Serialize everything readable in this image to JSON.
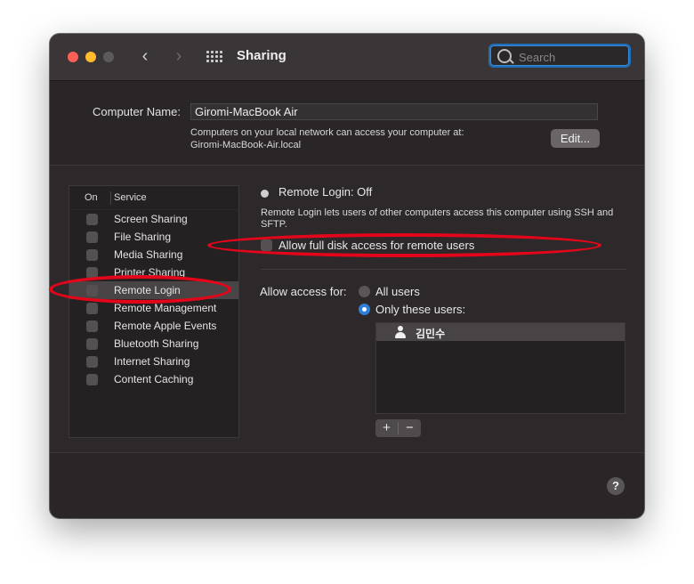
{
  "window": {
    "title": "Sharing",
    "search_placeholder": "Search",
    "nav_back": "‹",
    "nav_forward": "›"
  },
  "computer_name": {
    "label": "Computer Name:",
    "value": "Giromi-MacBook Air",
    "desc_line1": "Computers on your local network can access your computer at:",
    "desc_line2": "Giromi-MacBook-Air.local",
    "edit_label": "Edit..."
  },
  "services": {
    "header_on": "On",
    "header_service": "Service",
    "items": [
      {
        "label": "Screen Sharing",
        "checked": false
      },
      {
        "label": "File Sharing",
        "checked": false
      },
      {
        "label": "Media Sharing",
        "checked": false
      },
      {
        "label": "Printer Sharing",
        "checked": false
      },
      {
        "label": "Remote Login",
        "checked": false,
        "selected": true
      },
      {
        "label": "Remote Management",
        "checked": false
      },
      {
        "label": "Remote Apple Events",
        "checked": false
      },
      {
        "label": "Bluetooth Sharing",
        "checked": false
      },
      {
        "label": "Internet Sharing",
        "checked": false
      },
      {
        "label": "Content Caching",
        "checked": false
      }
    ]
  },
  "detail": {
    "status": "Remote Login: Off",
    "description": "Remote Login lets users of other computers access this computer using SSH and SFTP.",
    "full_disk_label": "Allow full disk access for remote users",
    "allow_access_label": "Allow access for:",
    "option_all": "All users",
    "option_only": "Only these users:",
    "selected_option": "Only these users:",
    "users": [
      "김민수"
    ],
    "add_label": "+",
    "remove_label": "−"
  },
  "help_label": "?",
  "colors": {
    "accent": "#2f7fd8",
    "annotation": "#e3061b",
    "close": "#fe5f57",
    "minimize": "#febc2e"
  }
}
